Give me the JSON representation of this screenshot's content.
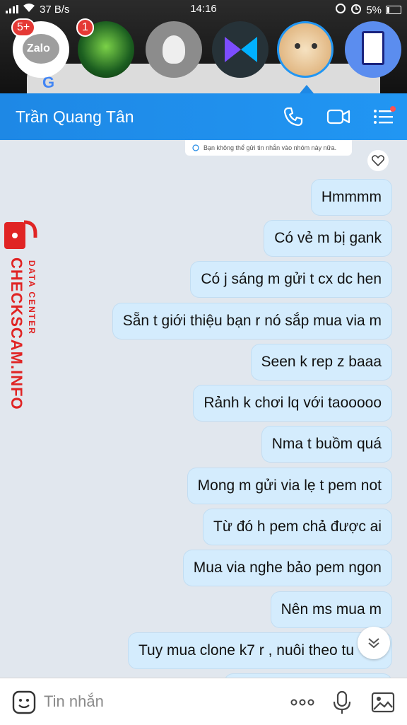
{
  "status_bar": {
    "network_speed": "37 B/s",
    "time": "14:16",
    "battery": "5%"
  },
  "chat_heads": [
    {
      "name": "Zalo",
      "badge": "5+",
      "color": "#ffffff"
    },
    {
      "name": "",
      "badge": "1",
      "color": "#1b5e20"
    },
    {
      "name": "",
      "badge": "",
      "color": "#9e9e9e"
    },
    {
      "name": "",
      "badge": "",
      "color": "#263238"
    },
    {
      "name": "",
      "badge": "",
      "color": "#f2d5a8"
    },
    {
      "name": "",
      "badge": "",
      "color": "#5b8def"
    }
  ],
  "header": {
    "contact_name": "Trần Quang Tân"
  },
  "notice": "Bạn không thể gửi tin nhắn vào nhóm này nữa.",
  "messages": [
    "Hmmmm",
    "Có vẻ m bị gank",
    "Có j sáng m gửi t cx dc hen",
    "Sẵn t giới thiệu bạn r nó sắp mua via m",
    "Seen k rep z baaa",
    "Rảnh k chơi lq với taooooo",
    "Nma t buồm quá",
    "Mong m gửi via lẹ t pem not",
    "Từ đó h pem chả được ai",
    "Mua via nghe bảo pem ngon",
    "Nên ms mua m",
    "Tuy mua clone k7 r , nuôi theo tu"
  ],
  "watermark": {
    "main": "CHECKSCAM.INFO",
    "sub": "DATA CENTER"
  },
  "input": {
    "placeholder": "Tin nhắn"
  },
  "colors": {
    "header": "#1e88e5",
    "bubble": "#d4ecfd",
    "chat_bg": "#e1e7ee",
    "watermark": "#e02424"
  }
}
